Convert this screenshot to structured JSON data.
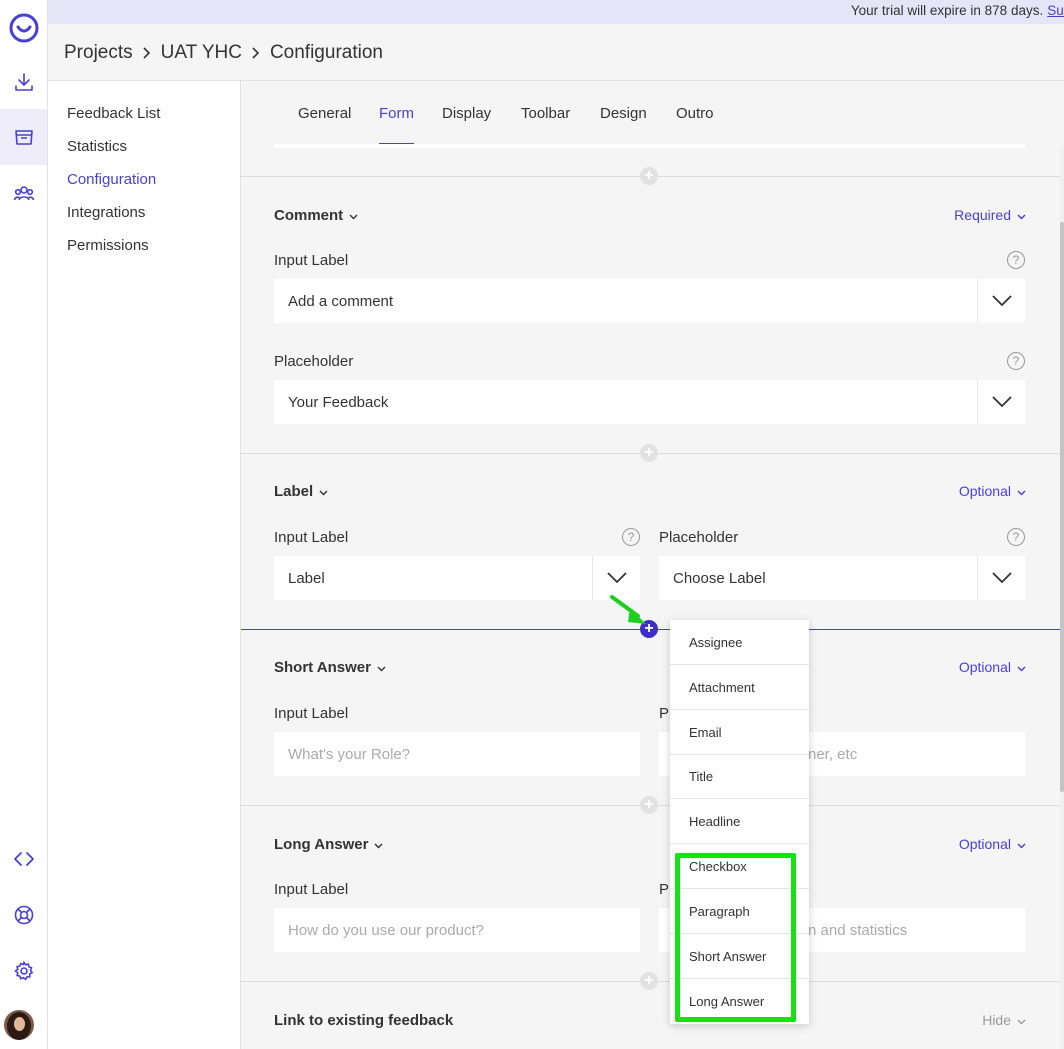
{
  "trial": {
    "text": "Your trial will expire in 878 days.",
    "link": "Subs"
  },
  "breadcrumb": [
    "Projects",
    "UAT YHC",
    "Configuration"
  ],
  "leftnav": [
    "Feedback List",
    "Statistics",
    "Configuration",
    "Integrations",
    "Permissions"
  ],
  "tabs": [
    "General",
    "Form",
    "Display",
    "Toolbar",
    "Design",
    "Outro"
  ],
  "colors": {
    "accent": "#4a3fd0",
    "highlight": "#16e016",
    "trial_bg": "#e6e4f7"
  },
  "icons": {
    "rail": [
      "logo-icon",
      "download-icon",
      "inbox-icon",
      "users-icon",
      "code-icon",
      "lifebuoy-icon",
      "gear-icon"
    ],
    "chevron": "chevron-down-icon",
    "help": "help-circle-icon"
  },
  "sections": {
    "comment": {
      "title": "Comment",
      "requirement": "Required",
      "input_label": "Input Label",
      "input_value": "Add a comment",
      "placeholder_label": "Placeholder",
      "placeholder_value": "Your Feedback"
    },
    "label": {
      "title": "Label",
      "requirement": "Optional",
      "input_label": "Input Label",
      "input_value": "Label",
      "placeholder_label": "Placeholder",
      "placeholder_value": "Choose Label"
    },
    "short_answer": {
      "title": "Short Answer",
      "requirement": "Optional",
      "input_label": "Input Label",
      "input_placeholder": "What's your Role?",
      "placeholder_label_partial": "P",
      "placeholder_value_partial": "ner, etc"
    },
    "long_answer": {
      "title": "Long Answer",
      "requirement": "Optional",
      "input_label": "Input Label",
      "input_placeholder": "How do you use our product?",
      "placeholder_label_partial": "P",
      "placeholder_value_partial": "n and statistics"
    },
    "link": {
      "title": "Link to existing feedback",
      "requirement": "Hide"
    }
  },
  "add_menu": [
    "Assignee",
    "Attachment",
    "Email",
    "Title",
    "Headline",
    "Checkbox",
    "Paragraph",
    "Short Answer",
    "Long Answer"
  ],
  "help_glyph": "?",
  "plus_glyph": "+"
}
